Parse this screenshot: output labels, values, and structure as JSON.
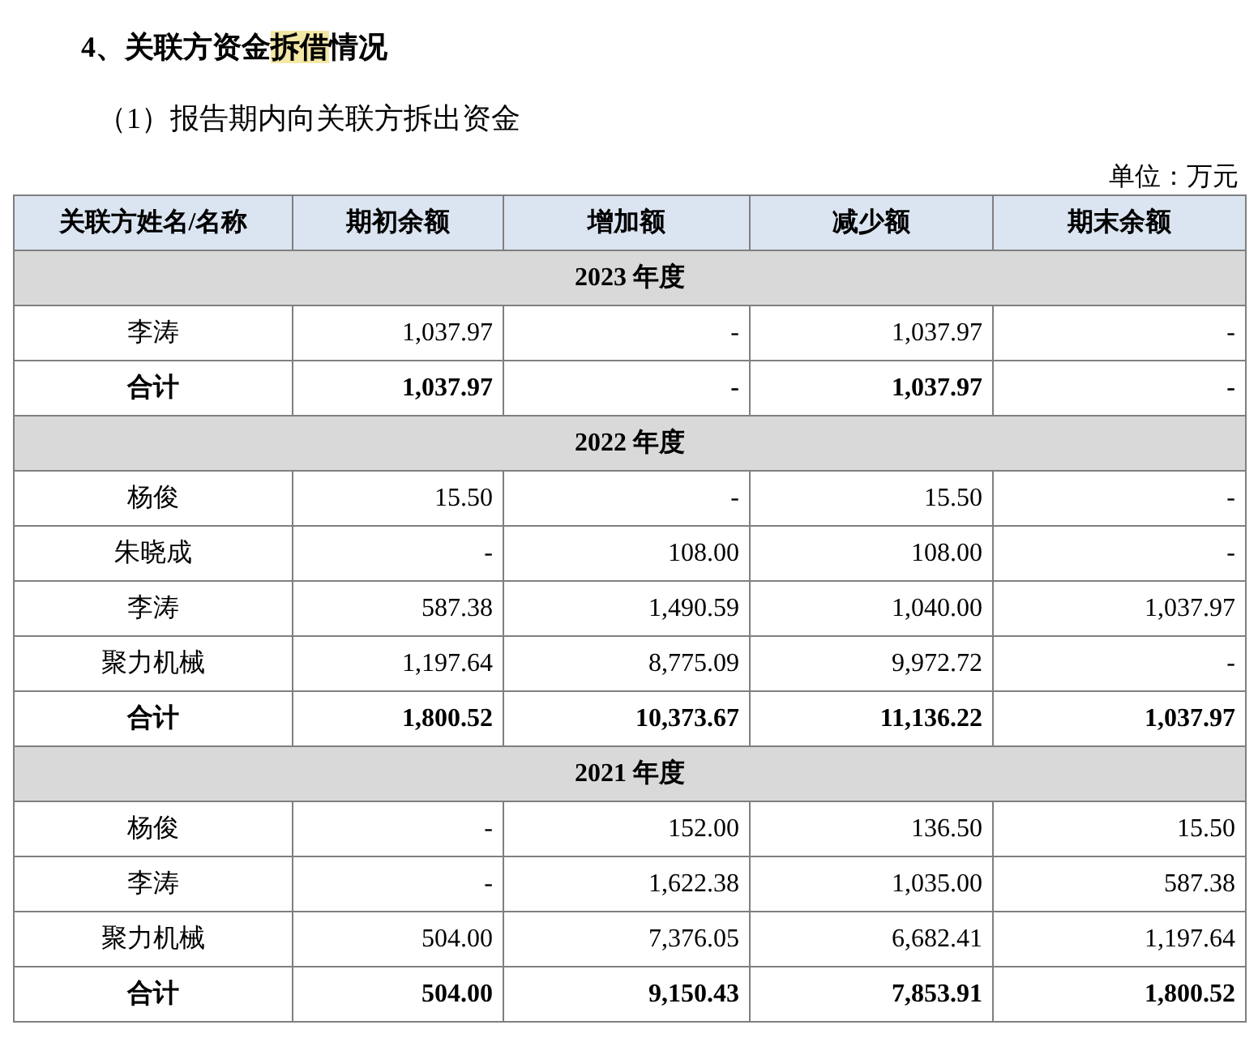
{
  "heading": {
    "segments": [
      {
        "text": "4、关联方资金",
        "highlighted": false
      },
      {
        "text": "拆借",
        "highlighted": true
      },
      {
        "text": "情况",
        "highlighted": false
      }
    ]
  },
  "subheading": "（1）报告期内向关联方拆出资金",
  "unit": "单位：万元",
  "table": {
    "columns": [
      "关联方姓名/名称",
      "期初余额",
      "增加额",
      "减少额",
      "期末余额"
    ],
    "sections": [
      {
        "label": "2023 年度",
        "rows": [
          {
            "kind": "item",
            "cells": [
              "李涛",
              "1,037.97",
              "-",
              "1,037.97",
              "-"
            ]
          },
          {
            "kind": "total",
            "cells": [
              "合计",
              "1,037.97",
              "-",
              "1,037.97",
              "-"
            ]
          }
        ]
      },
      {
        "label": "2022 年度",
        "rows": [
          {
            "kind": "item",
            "cells": [
              "杨俊",
              "15.50",
              "-",
              "15.50",
              "-"
            ]
          },
          {
            "kind": "item",
            "cells": [
              "朱晓成",
              "-",
              "108.00",
              "108.00",
              "-"
            ]
          },
          {
            "kind": "item",
            "cells": [
              "李涛",
              "587.38",
              "1,490.59",
              "1,040.00",
              "1,037.97"
            ]
          },
          {
            "kind": "item",
            "cells": [
              "聚力机械",
              "1,197.64",
              "8,775.09",
              "9,972.72",
              "-"
            ]
          },
          {
            "kind": "total",
            "cells": [
              "合计",
              "1,800.52",
              "10,373.67",
              "11,136.22",
              "1,037.97"
            ]
          }
        ]
      },
      {
        "label": "2021 年度",
        "rows": [
          {
            "kind": "item",
            "cells": [
              "杨俊",
              "-",
              "152.00",
              "136.50",
              "15.50"
            ]
          },
          {
            "kind": "item",
            "cells": [
              "李涛",
              "-",
              "1,622.38",
              "1,035.00",
              "587.38"
            ]
          },
          {
            "kind": "item",
            "cells": [
              "聚力机械",
              "504.00",
              "7,376.05",
              "6,682.41",
              "1,197.64"
            ]
          },
          {
            "kind": "total",
            "cells": [
              "合计",
              "504.00",
              "9,150.43",
              "7,853.91",
              "1,800.52"
            ]
          }
        ]
      }
    ]
  }
}
